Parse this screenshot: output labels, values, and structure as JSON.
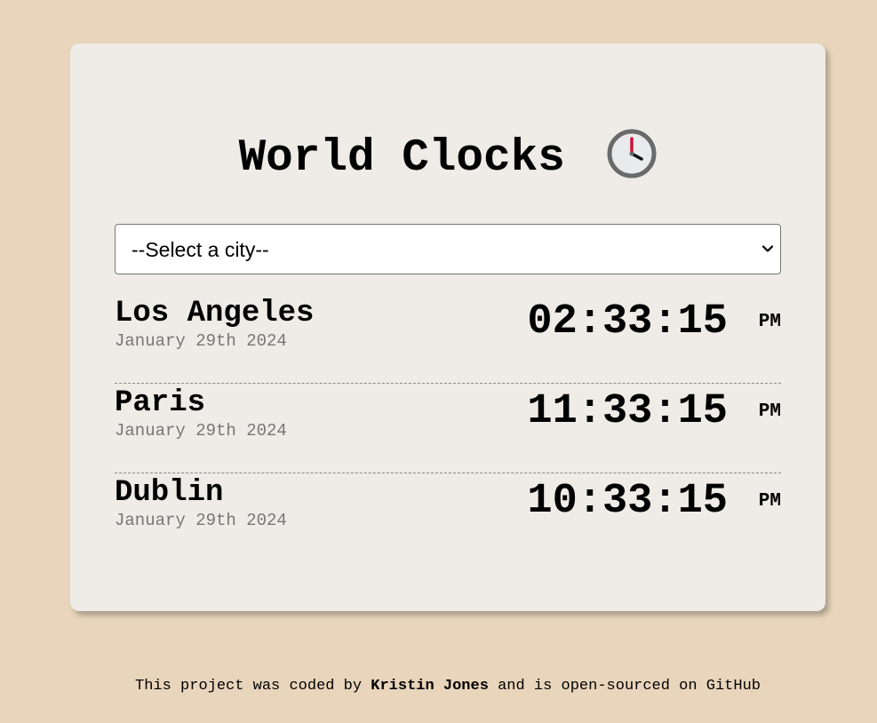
{
  "title": "World Clocks",
  "title_icon": "clock-three-oclock-icon",
  "city_select": {
    "selected": "--Select a city--"
  },
  "cities": [
    {
      "name": "Los Angeles",
      "date": "January 29th 2024",
      "time": "02:33:15",
      "ampm": "PM"
    },
    {
      "name": "Paris",
      "date": "January 29th 2024",
      "time": "11:33:15",
      "ampm": "PM"
    },
    {
      "name": "Dublin",
      "date": "January 29th 2024",
      "time": "10:33:15",
      "ampm": "PM"
    }
  ],
  "footer": {
    "prefix": "This project was coded by",
    "author": "Kristin Jones",
    "middle": "and is",
    "open_source_link": "open-sourced on GitHub"
  },
  "colors": {
    "page_background": "#e8d5bb",
    "card_background": "#efebe6",
    "date_text": "#777777"
  }
}
